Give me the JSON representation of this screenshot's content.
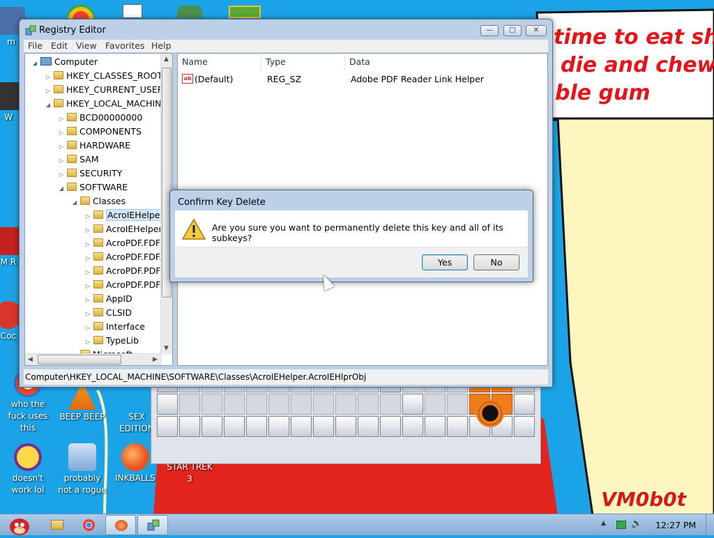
{
  "wallpaper": {
    "bubble_lines": [
      "time to eat shit",
      "die and chew",
      "ble gum"
    ],
    "watermark": "VM0b0t"
  },
  "desktop_icons": [
    {
      "label": "who the fuck uses this"
    },
    {
      "label": "BEEP BEEP"
    },
    {
      "label": "SEX EDITION"
    },
    {
      "label": "doesn't work lol"
    },
    {
      "label": "probably not a rogue"
    },
    {
      "label": "INKBALLS"
    },
    {
      "label": "STAR TREK 3"
    },
    {
      "label": "Coc"
    },
    {
      "label": "m"
    },
    {
      "label": "W"
    },
    {
      "label": "M R"
    }
  ],
  "registry_editor": {
    "title": "Registry Editor",
    "menu": [
      "File",
      "Edit",
      "View",
      "Favorites",
      "Help"
    ],
    "tree": [
      {
        "label": "Computer",
        "level": 0,
        "expanded": true
      },
      {
        "label": "HKEY_CLASSES_ROOT",
        "level": 1
      },
      {
        "label": "HKEY_CURRENT_USER",
        "level": 1
      },
      {
        "label": "HKEY_LOCAL_MACHINE",
        "level": 1,
        "expanded": true
      },
      {
        "label": "BCD00000000",
        "level": 2
      },
      {
        "label": "COMPONENTS",
        "level": 2
      },
      {
        "label": "HARDWARE",
        "level": 2
      },
      {
        "label": "SAM",
        "level": 2
      },
      {
        "label": "SECURITY",
        "level": 2
      },
      {
        "label": "SOFTWARE",
        "level": 2,
        "expanded": true
      },
      {
        "label": "Classes",
        "level": 3,
        "expanded": true
      },
      {
        "label": "AcroIEHelper",
        "level": 4,
        "selected": true
      },
      {
        "label": "AcroIEHelper",
        "level": 4
      },
      {
        "label": "AcroPDF.FDF",
        "level": 4
      },
      {
        "label": "AcroPDF.FDF.",
        "level": 4
      },
      {
        "label": "AcroPDF.PDF",
        "level": 4
      },
      {
        "label": "AcroPDF.PDF.",
        "level": 4
      },
      {
        "label": "AppID",
        "level": 4
      },
      {
        "label": "CLSID",
        "level": 4
      },
      {
        "label": "Interface",
        "level": 4
      },
      {
        "label": "TypeLib",
        "level": 4
      },
      {
        "label": "Microsoft",
        "level": 3
      }
    ],
    "columns": [
      "Name",
      "Type",
      "Data"
    ],
    "values": [
      {
        "name": "(Default)",
        "type": "REG_SZ",
        "data": "Adobe PDF Reader Link Helper"
      }
    ],
    "status_path": "Computer\\HKEY_LOCAL_MACHINE\\SOFTWARE\\Classes\\AcroIEHelper.AcroIEHlprObj",
    "window_buttons": {
      "minimize": "—",
      "maximize": "□",
      "close": "✕"
    }
  },
  "dialog": {
    "title": "Confirm Key Delete",
    "message": "Are you sure you want to permanently delete this key and all of its subkeys?",
    "yes_label": "Yes",
    "no_label": "No"
  },
  "taskbar": {
    "clock": "12:27 PM"
  },
  "colors": {
    "desktop_bg": "#1aa3e6",
    "bubble_text": "#e3151b",
    "orange_tile": "#f07d1a"
  }
}
